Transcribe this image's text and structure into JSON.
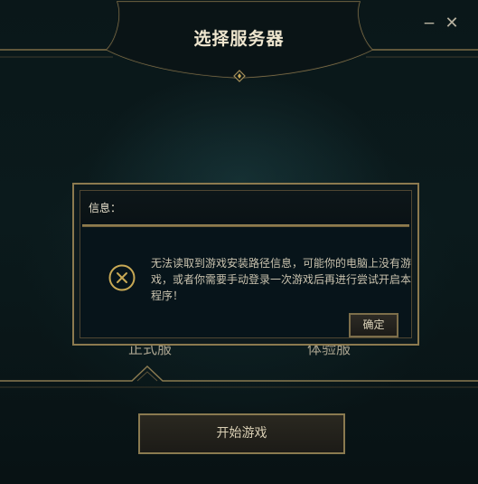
{
  "window": {
    "title": "选择服务器",
    "minimize_symbol": "−",
    "close_symbol": "✕"
  },
  "servers": {
    "official_label": "正式服",
    "test_label": "体验服"
  },
  "start_button_label": "开始游戏",
  "dialog": {
    "header_label": "信息：",
    "icon": "error-x-circle-icon",
    "message": "无法读取到游戏安装路径信息，可能你的电脑上没有游戏，或者你需要手动登录一次游戏后再进行尝试开启本程序！",
    "confirm_label": "确定"
  },
  "colors": {
    "gold_accent": "#8c7a4f",
    "background": "#0b1a1c",
    "title_text": "#efe6cf"
  }
}
